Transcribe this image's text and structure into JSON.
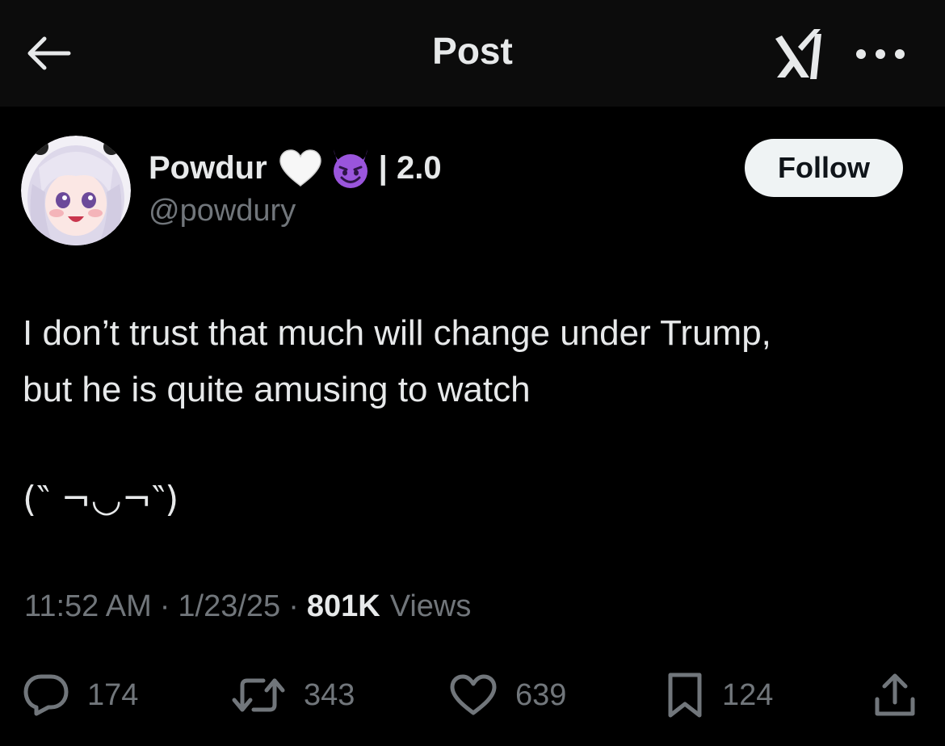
{
  "header": {
    "title": "Post",
    "back_icon": "arrow-left-icon",
    "grok_icon": "grok-icon",
    "more_icon": "more-horizontal-icon"
  },
  "author": {
    "display_name": "Powdur",
    "name_emoji": [
      "white-heart-icon",
      "smiling-devil-icon"
    ],
    "name_suffix": "| 2.0",
    "handle": "@powdury",
    "follow_label": "Follow"
  },
  "post": {
    "lines": [
      "I don’t trust that much will change under Trump,",
      "but he is quite amusing to watch"
    ],
    "kaomoji": "(‶ ¬◡¬‶)",
    "time": "11:52 AM",
    "date": "1/23/25",
    "views_count": "801K",
    "views_label": "Views"
  },
  "actions": {
    "reply": {
      "icon": "reply-icon",
      "count": "174"
    },
    "repost": {
      "icon": "repost-icon",
      "count": "343"
    },
    "like": {
      "icon": "heart-icon",
      "count": "639"
    },
    "bookmark": {
      "icon": "bookmark-icon",
      "count": "124"
    },
    "share": {
      "icon": "share-icon"
    }
  },
  "colors": {
    "background": "#000000",
    "header_background": "#0c0c0c",
    "text_primary": "#e7e9ea",
    "text_secondary": "#71767b",
    "follow_button_bg": "#eff3f4",
    "follow_button_text": "#0f1419"
  }
}
